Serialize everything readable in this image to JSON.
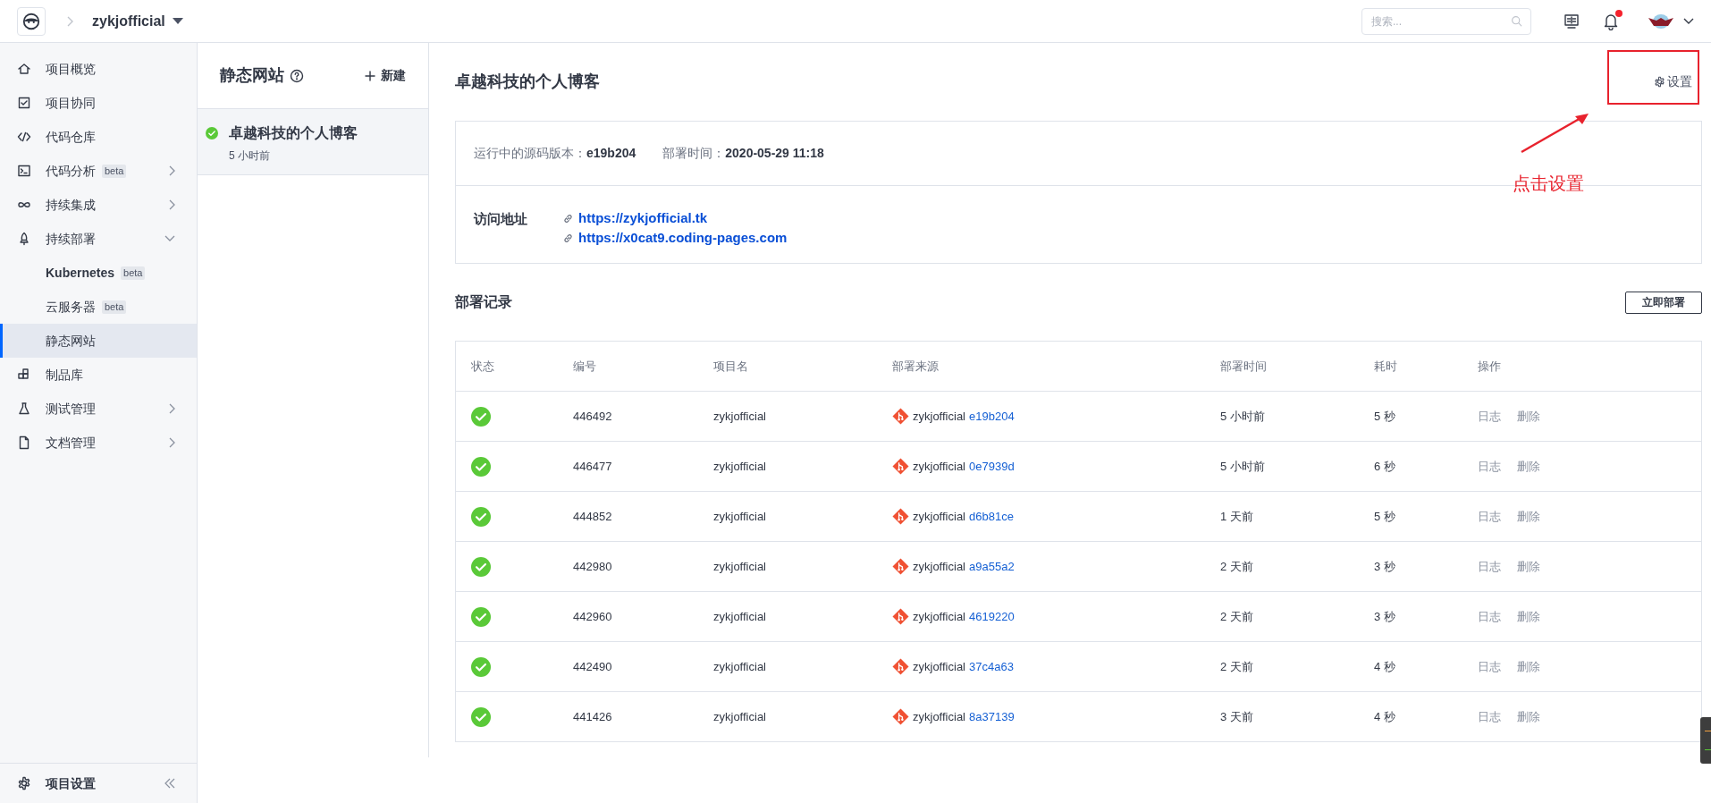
{
  "header": {
    "project": "zykjofficial",
    "search": {
      "placeholder": "搜索..."
    },
    "notification": true
  },
  "sidebar": {
    "items": [
      {
        "label": "项目概览",
        "selected": false
      },
      {
        "label": "项目协同",
        "selected": false
      },
      {
        "label": "代码仓库",
        "selected": false
      },
      {
        "label": "代码分析",
        "badge": "beta",
        "selected": false,
        "expanded": false
      },
      {
        "label": "持续集成",
        "selected": false,
        "expanded": false
      },
      {
        "label": "持续部署",
        "selected": false,
        "expanded": true,
        "children": [
          {
            "label": "Kubernetes",
            "badge": "beta",
            "selected": false
          },
          {
            "label": "云服务器",
            "badge": "beta",
            "selected": false
          },
          {
            "label": "静态网站",
            "selected": true
          }
        ]
      },
      {
        "label": "制品库",
        "selected": false
      },
      {
        "label": "测试管理",
        "selected": false,
        "expanded": false
      },
      {
        "label": "文档管理",
        "selected": false,
        "expanded": false
      }
    ],
    "footer": "项目设置"
  },
  "site_list": {
    "title": "静态网站",
    "new_button": "新建",
    "items": [
      {
        "name": "卓越科技的个人博客",
        "time": "5 小时前",
        "selected": true
      }
    ]
  },
  "detail": {
    "title": "卓越科技的个人博客",
    "settings": "设置",
    "info": {
      "version_label": "运行中的源码版本：",
      "version": "e19b204",
      "time_label": "部署时间：",
      "time": "2020-05-29 11:18",
      "address_label": "访问地址",
      "links": [
        "https://zykjofficial.tk",
        "https://x0cat9.coding-pages.com"
      ]
    },
    "records_title": "部署记录",
    "deploy_button": "立即部署",
    "table": {
      "columns": [
        "状态",
        "编号",
        "项目名",
        "部署来源",
        "部署时间",
        "耗时",
        "操作"
      ],
      "rows": [
        {
          "id": "446492",
          "project": "zykjofficial",
          "source": "zykjofficial",
          "commit": "e19b204",
          "time": "5 小时前",
          "duration": "5 秒",
          "actions": [
            "日志",
            "删除"
          ]
        },
        {
          "id": "446477",
          "project": "zykjofficial",
          "source": "zykjofficial",
          "commit": "0e7939d",
          "time": "5 小时前",
          "duration": "6 秒",
          "actions": [
            "日志",
            "删除"
          ]
        },
        {
          "id": "444852",
          "project": "zykjofficial",
          "source": "zykjofficial",
          "commit": "d6b81ce",
          "time": "1 天前",
          "duration": "5 秒",
          "actions": [
            "日志",
            "删除"
          ]
        },
        {
          "id": "442980",
          "project": "zykjofficial",
          "source": "zykjofficial",
          "commit": "a9a55a2",
          "time": "2 天前",
          "duration": "3 秒",
          "actions": [
            "日志",
            "删除"
          ]
        },
        {
          "id": "442960",
          "project": "zykjofficial",
          "source": "zykjofficial",
          "commit": "4619220",
          "time": "2 天前",
          "duration": "3 秒",
          "actions": [
            "日志",
            "删除"
          ]
        },
        {
          "id": "442490",
          "project": "zykjofficial",
          "source": "zykjofficial",
          "commit": "37c4a63",
          "time": "2 天前",
          "duration": "4 秒",
          "actions": [
            "日志",
            "删除"
          ]
        },
        {
          "id": "441426",
          "project": "zykjofficial",
          "source": "zykjofficial",
          "commit": "8a37139",
          "time": "3 天前",
          "duration": "4 秒",
          "actions": [
            "日志",
            "删除"
          ]
        }
      ]
    }
  },
  "annotation": {
    "text": "点击设置"
  }
}
